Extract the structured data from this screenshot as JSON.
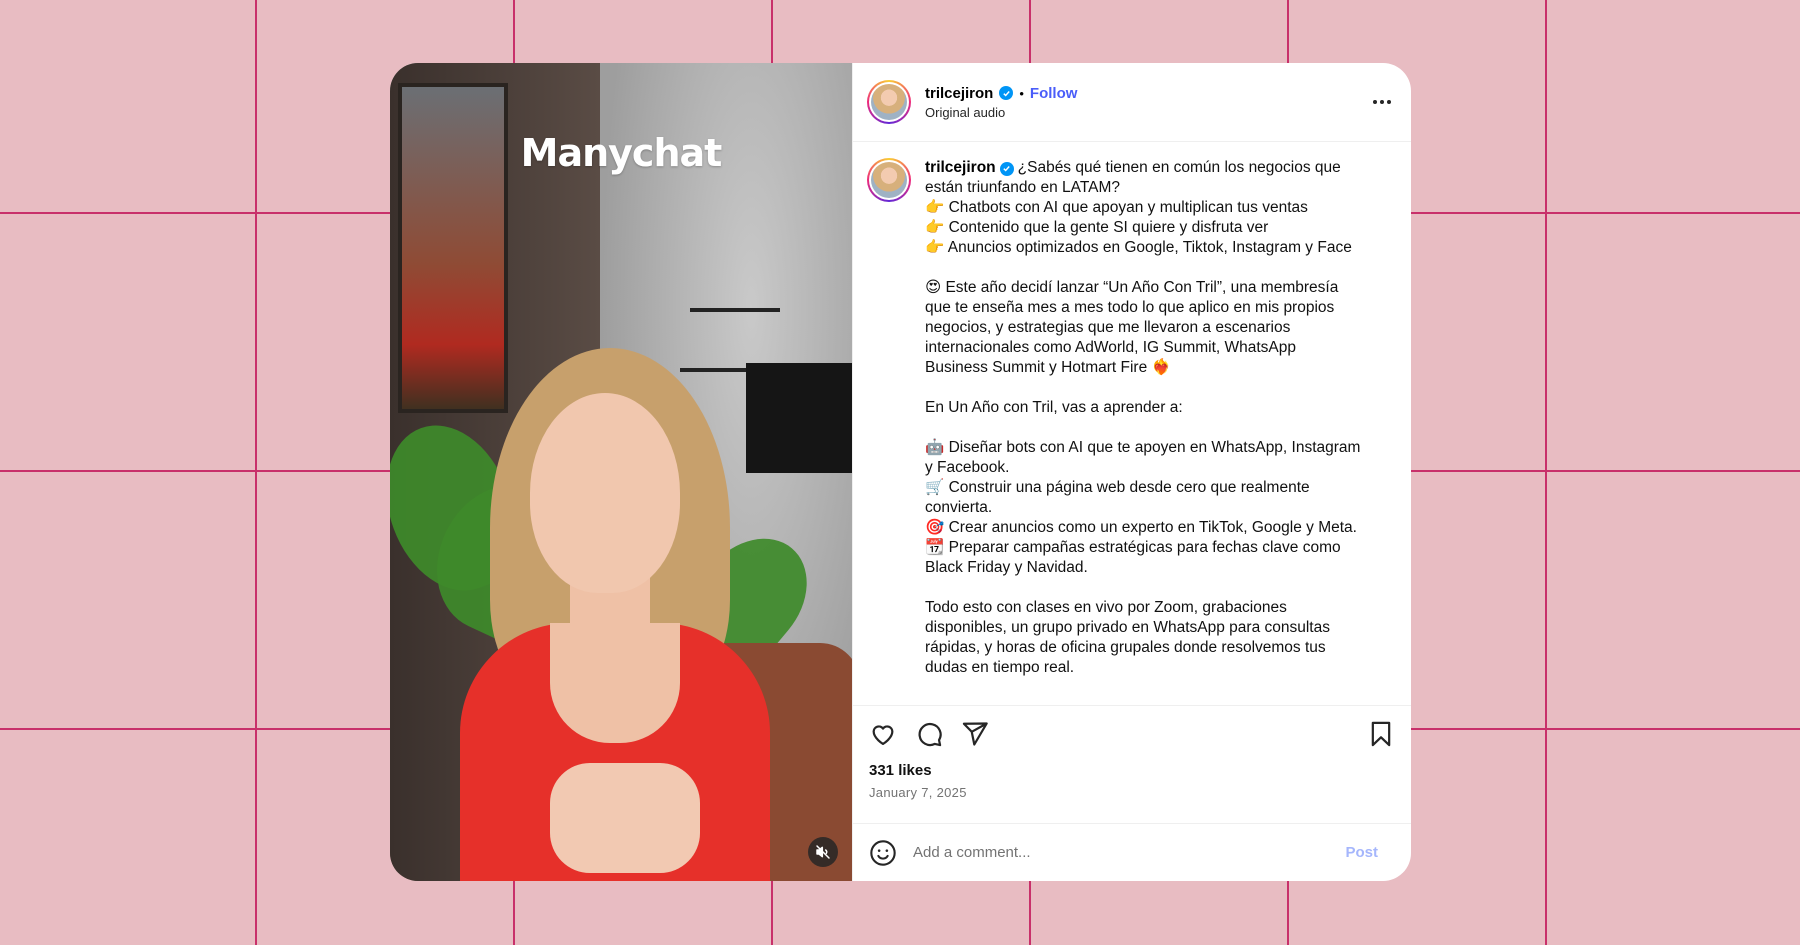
{
  "media": {
    "brand_overlay": "Manychat",
    "mute_icon": "speaker-muted-icon"
  },
  "post": {
    "username": "trilcejiron",
    "verified_icon": "verified-badge-icon",
    "separator": "•",
    "follow_label": "Follow",
    "audio_label": "Original audio",
    "more_icon": "more-horizontal-icon",
    "caption_first_line": "¿Sabés qué tienen en común los negocios que",
    "caption_lines": [
      "están triunfando en LATAM?",
      "👉 Chatbots con AI que apoyan y multiplican tus ventas",
      "👉 Contenido que la gente SI quiere y disfruta ver",
      "👉 Anuncios optimizados en Google, Tiktok, Instagram y Face",
      "",
      "😍 Este año decidí lanzar “Un Año Con Tril”, una membresía",
      "que te enseña mes a mes todo lo que aplico en mis propios",
      "negocios, y estrategias que me llevaron a escenarios",
      "internacionales como AdWorld, IG Summit, WhatsApp",
      "Business Summit y Hotmart Fire ❤️‍🔥",
      "",
      "En Un Año con Tril, vas a aprender a:",
      "",
      "🤖 Diseñar bots con AI que te apoyen en WhatsApp, Instagram",
      "y Facebook.",
      "🛒 Construir una página web desde cero que realmente",
      "convierta.",
      "🎯 Crear anuncios como un experto en TikTok, Google y Meta.",
      "📆 Preparar campañas estratégicas para fechas clave como",
      "Black Friday y Navidad.",
      "",
      "Todo esto con clases en vivo por Zoom, grabaciones",
      "disponibles, un grupo privado en WhatsApp para consultas",
      "rápidas, y horas de oficina grupales donde resolvemos tus",
      "dudas en tiempo real."
    ],
    "likes": "331 likes",
    "date": "January 7, 2025"
  },
  "actions": {
    "like_icon": "heart-icon",
    "comment_icon": "comment-bubble-icon",
    "share_icon": "send-paper-plane-icon",
    "save_icon": "bookmark-icon"
  },
  "comment": {
    "emoji_icon": "smiley-emoji-icon",
    "placeholder": "Add a comment...",
    "post_label": "Post"
  },
  "colors": {
    "background": "#e8bcc2",
    "grid_lines": "#c8306a",
    "follow_blue": "#4a5df9",
    "verified_blue": "#0095f6",
    "post_disabled": "#a5b6fc"
  }
}
